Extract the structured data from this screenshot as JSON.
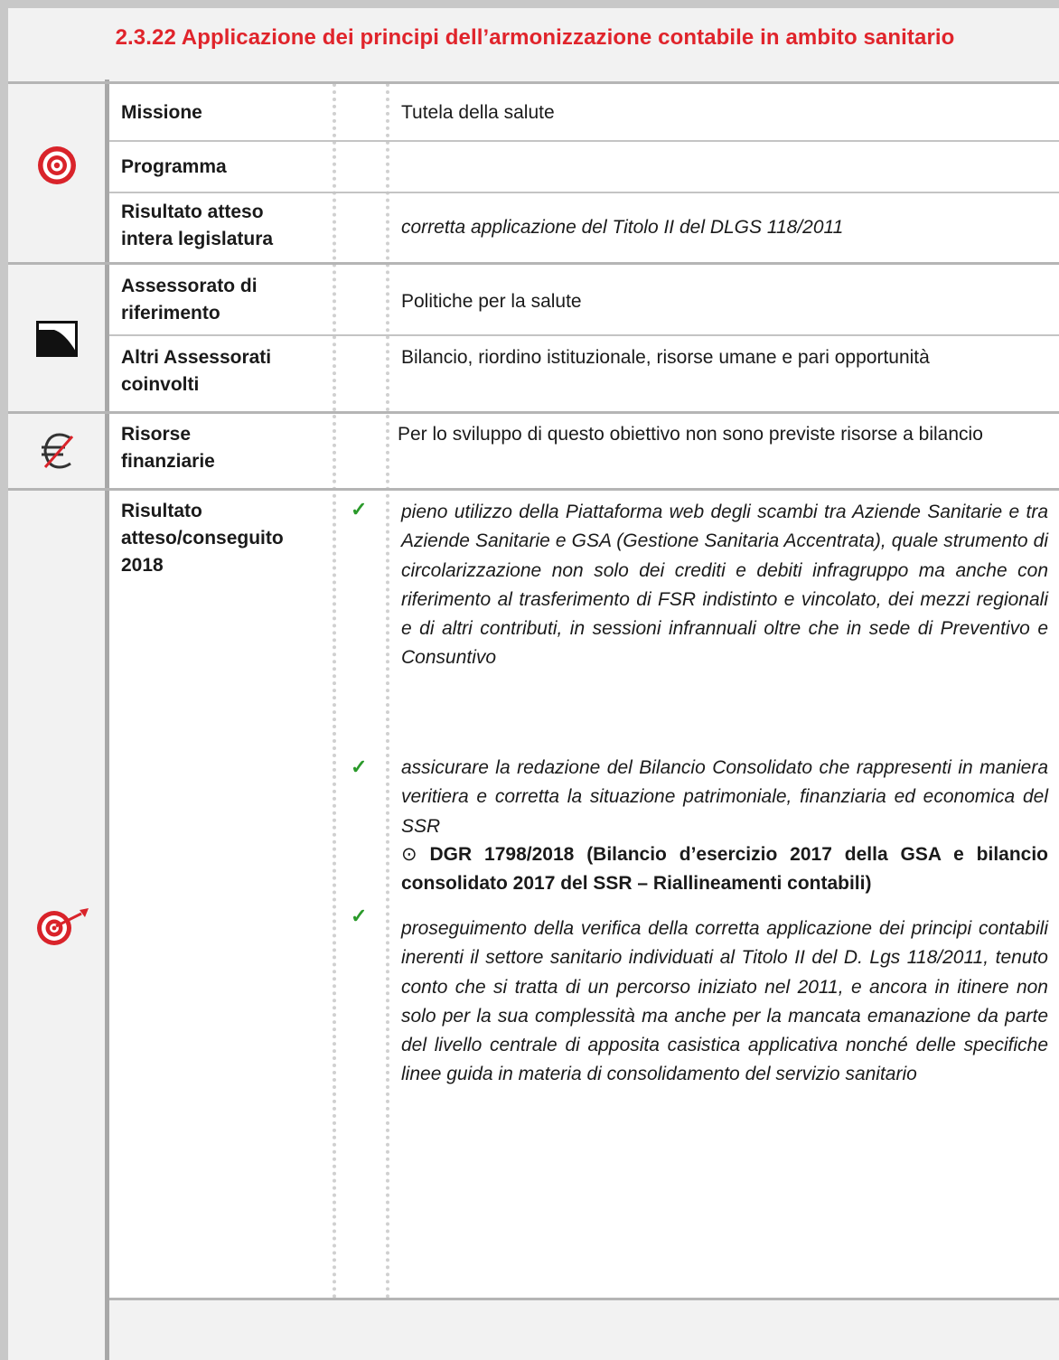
{
  "title": "2.3.22 Applicazione dei principi dell’armonizzazione contabile in ambito sanitario",
  "rows": {
    "missione": {
      "label": "Missione",
      "value": "Tutela della salute"
    },
    "programma": {
      "label": "Programma",
      "value": ""
    },
    "risultato_legislatura": {
      "label_line1": "Risultato atteso",
      "label_line2": "intera legislatura",
      "value": "corretta applicazione del Titolo II del DLGS 118/2011"
    },
    "assessorato": {
      "label_line1": "Assessorato di",
      "label_line2": "riferimento",
      "value": "Politiche per la salute"
    },
    "altri_assessorati": {
      "label_line1": "Altri Assessorati",
      "label_line2": "coinvolti",
      "value": "Bilancio, riordino istituzionale, risorse umane e pari opportunità"
    },
    "risorse": {
      "label_line1": "Risorse",
      "label_line2": "finanziarie",
      "value": "Per lo sviluppo di questo obiettivo non sono previste risorse a bilancio"
    },
    "risultato_2018": {
      "label_line1": "Risultato",
      "label_line2": "atteso/conseguito",
      "label_line3": "2018",
      "items": [
        "pieno utilizzo della Piattaforma web degli scambi tra Aziende Sanitarie e tra Aziende Sanitarie e GSA (Gestione Sanitaria Accentrata), quale strumento di circolarizzazione non solo dei crediti e debiti infragruppo ma anche  con riferimento al trasferimento di FSR indistinto e vincolato, dei mezzi regionali e di altri contributi, in sessioni infrannuali oltre che in sede di Preventivo e Consuntivo",
        "assicurare la redazione del Bilancio Consolidato che rappresenti in maniera veritiera e corretta la situazione patrimoniale, finanziaria ed economica del SSR",
        "proseguimento della verifica della corretta applicazione dei principi contabili inerenti il settore sanitario individuati al Titolo II del D. Lgs 118/2011, tenuto conto che si tratta di un percorso iniziato nel 2011, e ancora in itinere non solo per la sua complessità ma anche per la mancata emanazione da parte del livello centrale di apposita casistica applicativa nonché delle specifiche linee guida in materia di consolidamento del servizio sanitario"
      ],
      "dgr_bullet": "⊙",
      "dgr_note": "DGR 1798/2018 (Bilancio d’esercizio 2017 della GSA e bilancio consolidato 2017 del SSR – Riallineamenti contabili)",
      "check_symbol": "✓"
    }
  },
  "icons": {
    "objective": "target-icon",
    "assessorato": "flag-icon",
    "resources": "no-euro-icon",
    "results": "target-dart-icon"
  },
  "colors": {
    "title": "#e0242b",
    "check": "#2a9a2a",
    "target_red": "#d9232a"
  }
}
